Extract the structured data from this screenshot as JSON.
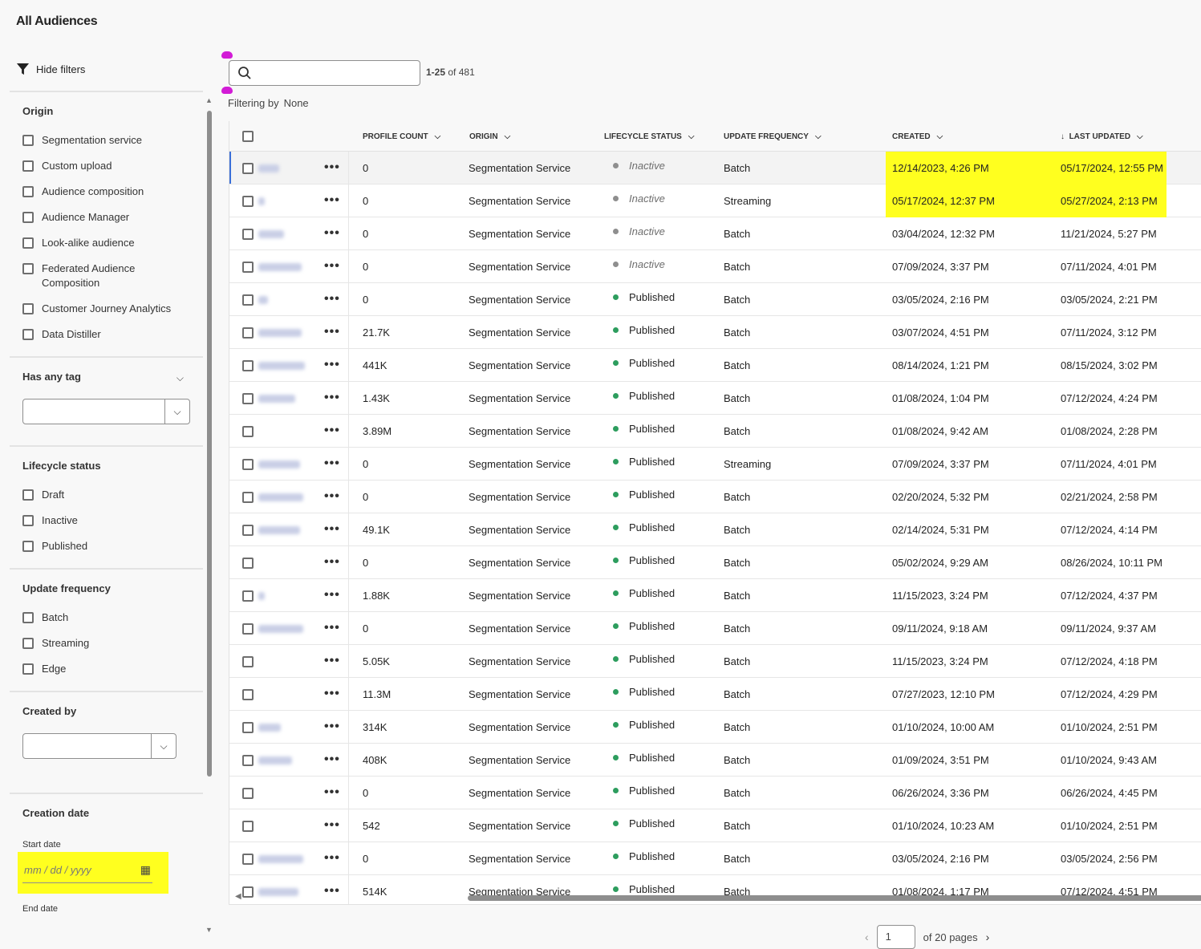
{
  "page": {
    "title": "All Audiences"
  },
  "filters": {
    "toggle_label": "Hide filters",
    "origin": {
      "title": "Origin",
      "options": [
        "Segmentation service",
        "Custom upload",
        "Audience composition",
        "Audience Manager",
        "Look-alike audience",
        "Federated Audience Composition",
        "Customer Journey Analytics",
        "Data Distiller"
      ]
    },
    "tag": {
      "title": "Has any tag"
    },
    "lifecycle": {
      "title": "Lifecycle status",
      "options": [
        "Draft",
        "Inactive",
        "Published"
      ]
    },
    "frequency": {
      "title": "Update frequency",
      "options": [
        "Batch",
        "Streaming",
        "Edge"
      ]
    },
    "created_by": {
      "title": "Created by"
    },
    "creation_date": {
      "title": "Creation date",
      "start_label": "Start date",
      "start_placeholder": "mm / dd / yyyy",
      "end_label": "End date"
    }
  },
  "search": {
    "placeholder": "",
    "count_range": "1-25",
    "count_total": "of 481"
  },
  "filtering": {
    "label": "Filtering by",
    "value": "None"
  },
  "columns": {
    "profile_count": "PROFILE COUNT",
    "origin": "ORIGIN",
    "lifecycle": "LIFECYCLE STATUS",
    "frequency": "UPDATE FREQUENCY",
    "created": "CREATED",
    "last_updated": "LAST UPDATED"
  },
  "highlight_color": "#ffff1f",
  "status_colors": {
    "Inactive": "#8e8e8e",
    "Published": "#2d9d5e"
  },
  "rows": [
    {
      "count": "0",
      "origin": "Segmentation Service",
      "status": "Inactive",
      "freq": "Batch",
      "created": "12/14/2023, 4:26 PM",
      "updated": "05/17/2024, 12:55 PM"
    },
    {
      "count": "0",
      "origin": "Segmentation Service",
      "status": "Inactive",
      "freq": "Streaming",
      "created": "05/17/2024, 12:37 PM",
      "updated": "05/27/2024, 2:13 PM"
    },
    {
      "count": "0",
      "origin": "Segmentation Service",
      "status": "Inactive",
      "freq": "Batch",
      "created": "03/04/2024, 12:32 PM",
      "updated": "11/21/2024, 5:27 PM"
    },
    {
      "count": "0",
      "origin": "Segmentation Service",
      "status": "Inactive",
      "freq": "Batch",
      "created": "07/09/2024, 3:37 PM",
      "updated": "07/11/2024, 4:01 PM"
    },
    {
      "count": "0",
      "origin": "Segmentation Service",
      "status": "Published",
      "freq": "Batch",
      "created": "03/05/2024, 2:16 PM",
      "updated": "03/05/2024, 2:21 PM"
    },
    {
      "count": "21.7K",
      "origin": "Segmentation Service",
      "status": "Published",
      "freq": "Batch",
      "created": "03/07/2024, 4:51 PM",
      "updated": "07/11/2024, 3:12 PM"
    },
    {
      "count": "441K",
      "origin": "Segmentation Service",
      "status": "Published",
      "freq": "Batch",
      "created": "08/14/2024, 1:21 PM",
      "updated": "08/15/2024, 3:02 PM"
    },
    {
      "count": "1.43K",
      "origin": "Segmentation Service",
      "status": "Published",
      "freq": "Batch",
      "created": "01/08/2024, 1:04 PM",
      "updated": "07/12/2024, 4:24 PM"
    },
    {
      "count": "3.89M",
      "origin": "Segmentation Service",
      "status": "Published",
      "freq": "Batch",
      "created": "01/08/2024, 9:42 AM",
      "updated": "01/08/2024, 2:28 PM"
    },
    {
      "count": "0",
      "origin": "Segmentation Service",
      "status": "Published",
      "freq": "Streaming",
      "created": "07/09/2024, 3:37 PM",
      "updated": "07/11/2024, 4:01 PM"
    },
    {
      "count": "0",
      "origin": "Segmentation Service",
      "status": "Published",
      "freq": "Batch",
      "created": "02/20/2024, 5:32 PM",
      "updated": "02/21/2024, 2:58 PM"
    },
    {
      "count": "49.1K",
      "origin": "Segmentation Service",
      "status": "Published",
      "freq": "Batch",
      "created": "02/14/2024, 5:31 PM",
      "updated": "07/12/2024, 4:14 PM"
    },
    {
      "count": "0",
      "origin": "Segmentation Service",
      "status": "Published",
      "freq": "Batch",
      "created": "05/02/2024, 9:29 AM",
      "updated": "08/26/2024, 10:11 PM"
    },
    {
      "count": "1.88K",
      "origin": "Segmentation Service",
      "status": "Published",
      "freq": "Batch",
      "created": "11/15/2023, 3:24 PM",
      "updated": "07/12/2024, 4:37 PM"
    },
    {
      "count": "0",
      "origin": "Segmentation Service",
      "status": "Published",
      "freq": "Batch",
      "created": "09/11/2024, 9:18 AM",
      "updated": "09/11/2024, 9:37 AM"
    },
    {
      "count": "5.05K",
      "origin": "Segmentation Service",
      "status": "Published",
      "freq": "Batch",
      "created": "11/15/2023, 3:24 PM",
      "updated": "07/12/2024, 4:18 PM"
    },
    {
      "count": "11.3M",
      "origin": "Segmentation Service",
      "status": "Published",
      "freq": "Batch",
      "created": "07/27/2023, 12:10 PM",
      "updated": "07/12/2024, 4:29 PM"
    },
    {
      "count": "314K",
      "origin": "Segmentation Service",
      "status": "Published",
      "freq": "Batch",
      "created": "01/10/2024, 10:00 AM",
      "updated": "01/10/2024, 2:51 PM"
    },
    {
      "count": "408K",
      "origin": "Segmentation Service",
      "status": "Published",
      "freq": "Batch",
      "created": "01/09/2024, 3:51 PM",
      "updated": "01/10/2024, 9:43 AM"
    },
    {
      "count": "0",
      "origin": "Segmentation Service",
      "status": "Published",
      "freq": "Batch",
      "created": "06/26/2024, 3:36 PM",
      "updated": "06/26/2024, 4:45 PM"
    },
    {
      "count": "542",
      "origin": "Segmentation Service",
      "status": "Published",
      "freq": "Batch",
      "created": "01/10/2024, 10:23 AM",
      "updated": "01/10/2024, 2:51 PM"
    },
    {
      "count": "0",
      "origin": "Segmentation Service",
      "status": "Published",
      "freq": "Batch",
      "created": "03/05/2024, 2:16 PM",
      "updated": "03/05/2024, 2:56 PM"
    },
    {
      "count": "514K",
      "origin": "Segmentation Service",
      "status": "Published",
      "freq": "Batch",
      "created": "01/08/2024, 1:17 PM",
      "updated": "07/12/2024, 4:51 PM"
    }
  ],
  "pagination": {
    "current": "1",
    "total_label": "of 20 pages"
  }
}
